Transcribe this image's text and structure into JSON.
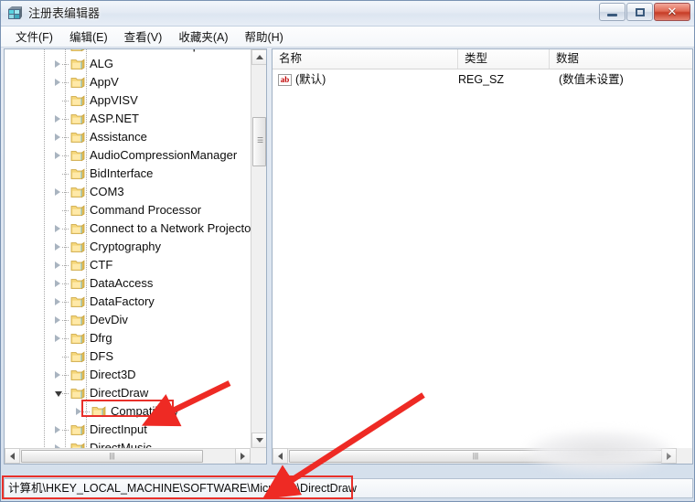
{
  "window": {
    "title": "注册表编辑器",
    "icon": "regedit-icon",
    "buttons": {
      "minimize": "最小化",
      "maximize": "最大化",
      "close": "✕"
    }
  },
  "menubar": {
    "items": [
      {
        "label": "文件(F)",
        "name": "menu-file"
      },
      {
        "label": "编辑(E)",
        "name": "menu-edit"
      },
      {
        "label": "查看(V)",
        "name": "menu-view"
      },
      {
        "label": "收藏夹(A)",
        "name": "menu-favorites"
      },
      {
        "label": "帮助(H)",
        "name": "menu-help"
      }
    ]
  },
  "tree": {
    "nodes": [
      {
        "label": "Advanced INF Setup",
        "depth": 3,
        "expander": "closed",
        "selected": false
      },
      {
        "label": "ALG",
        "depth": 3,
        "expander": "closed",
        "selected": false
      },
      {
        "label": "AppV",
        "depth": 3,
        "expander": "closed",
        "selected": false
      },
      {
        "label": "AppVISV",
        "depth": 3,
        "expander": "none",
        "selected": false
      },
      {
        "label": "ASP.NET",
        "depth": 3,
        "expander": "closed",
        "selected": false
      },
      {
        "label": "Assistance",
        "depth": 3,
        "expander": "closed",
        "selected": false
      },
      {
        "label": "AudioCompressionManager",
        "depth": 3,
        "expander": "closed",
        "selected": false
      },
      {
        "label": "BidInterface",
        "depth": 3,
        "expander": "none",
        "selected": false
      },
      {
        "label": "COM3",
        "depth": 3,
        "expander": "closed",
        "selected": false
      },
      {
        "label": "Command Processor",
        "depth": 3,
        "expander": "none",
        "selected": false
      },
      {
        "label": "Connect to a Network Projector",
        "depth": 3,
        "expander": "closed",
        "selected": false
      },
      {
        "label": "Cryptography",
        "depth": 3,
        "expander": "closed",
        "selected": false
      },
      {
        "label": "CTF",
        "depth": 3,
        "expander": "closed",
        "selected": false
      },
      {
        "label": "DataAccess",
        "depth": 3,
        "expander": "closed",
        "selected": false
      },
      {
        "label": "DataFactory",
        "depth": 3,
        "expander": "closed",
        "selected": false
      },
      {
        "label": "DevDiv",
        "depth": 3,
        "expander": "closed",
        "selected": false
      },
      {
        "label": "Dfrg",
        "depth": 3,
        "expander": "closed",
        "selected": false
      },
      {
        "label": "DFS",
        "depth": 3,
        "expander": "none",
        "selected": false
      },
      {
        "label": "Direct3D",
        "depth": 3,
        "expander": "closed",
        "selected": false
      },
      {
        "label": "DirectDraw",
        "depth": 3,
        "expander": "open",
        "selected": true
      },
      {
        "label": "Compatibility",
        "depth": 4,
        "expander": "closed",
        "selected": false
      },
      {
        "label": "DirectInput",
        "depth": 3,
        "expander": "closed",
        "selected": false
      },
      {
        "label": "DirectMusic",
        "depth": 3,
        "expander": "closed",
        "selected": false
      }
    ]
  },
  "list": {
    "columns": [
      {
        "label": "名称",
        "name": "column-name"
      },
      {
        "label": "类型",
        "name": "column-type"
      },
      {
        "label": "数据",
        "name": "column-data"
      }
    ],
    "rows": [
      {
        "icon": "string-value-icon",
        "name": "(默认)",
        "type": "REG_SZ",
        "data": "(数值未设置)"
      }
    ]
  },
  "statusbar": {
    "path": "计算机\\HKEY_LOCAL_MACHINE\\SOFTWARE\\Microsoft\\DirectDraw"
  },
  "annotations": {
    "highlight_color": "#e8302a",
    "arrow_color": "#ee2a24",
    "items": [
      {
        "name": "highlight-directdraw-node",
        "kind": "rectangle"
      },
      {
        "name": "highlight-status-path",
        "kind": "rectangle"
      },
      {
        "name": "arrow-to-directdraw-node",
        "kind": "arrow"
      },
      {
        "name": "arrow-to-status-path",
        "kind": "arrow"
      }
    ]
  }
}
